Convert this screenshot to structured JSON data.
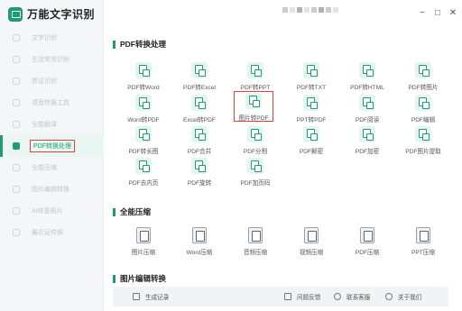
{
  "app": {
    "title": "万能文字识别"
  },
  "sidebar": {
    "items": [
      {
        "label": "文字识别",
        "active": false
      },
      {
        "label": "生活常用识别",
        "active": false
      },
      {
        "label": "票证识别",
        "active": false
      },
      {
        "label": "语音转换工具",
        "active": false
      },
      {
        "label": "全能翻译",
        "active": false
      },
      {
        "label": "PDF转换处理",
        "active": true
      },
      {
        "label": "全能压缩",
        "active": false
      },
      {
        "label": "图片编辑转换",
        "active": false
      },
      {
        "label": "AI修复照片",
        "active": false
      },
      {
        "label": "最近证件照",
        "active": false
      }
    ]
  },
  "window": {
    "minimize": "−",
    "maximize": "□",
    "close": "✕"
  },
  "sections": {
    "pdf": {
      "title": "PDF转换处理",
      "tools": [
        "PDF转Word",
        "PDF转Excel",
        "PDF转PPT",
        "PDF转TXT",
        "PDF转HTML",
        "PDF转图片",
        "Word转PDF",
        "Excel转PDF",
        "图片转PDF",
        "PPT转PDF",
        "PDF阅读",
        "PDF编辑",
        "PDF转长图",
        "PDF合并",
        "PDF分割",
        "PDF解密",
        "PDF加密",
        "PDF图片提取",
        "PDF去内页",
        "PDF旋转",
        "PDF加页码"
      ],
      "highlighted": "图片转PDF"
    },
    "compress": {
      "title": "全能压缩",
      "tools": [
        "图片压缩",
        "Word压缩",
        "音频压缩",
        "视频压缩",
        "PDF压缩",
        "PPT压缩"
      ]
    },
    "image": {
      "title": "图片编辑转换"
    }
  },
  "footer": {
    "history": "生成记录",
    "feedback": "问题反馈",
    "contact": "联系客服",
    "about": "关于我们"
  },
  "colors": {
    "accent": "#1f9a76",
    "highlight": "#e0413a"
  }
}
